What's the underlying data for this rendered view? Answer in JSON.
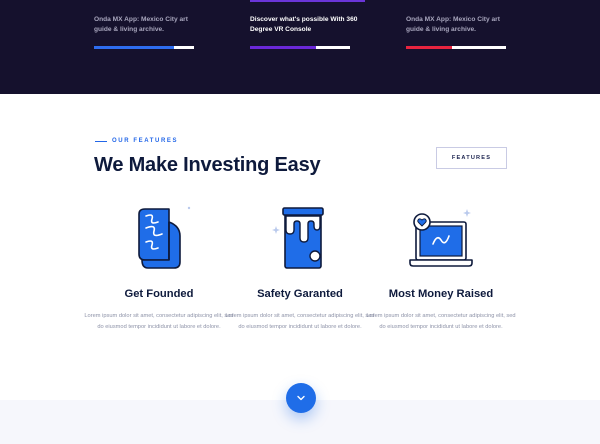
{
  "slider": {
    "slides": [
      {
        "text": "Onda MX App: Mexico City art guide & living archive.",
        "progress": 0.8,
        "color": "#2e6df0"
      },
      {
        "text": "Discover what's possible With 360 Degree VR Console",
        "progress": 0.66,
        "color": "#6a28d8"
      },
      {
        "text": "Onda MX App: Mexico City art guide & living archive.",
        "progress": 0.46,
        "color": "#e8243f"
      }
    ],
    "active_index": 1
  },
  "features_section": {
    "eyebrow": "OUR FEATURES",
    "heading": "We Make Investing Easy",
    "button_label": "FEATURES",
    "items": [
      {
        "title": "Get Founded",
        "icon": "document-icon",
        "description": "Lorem ipsum dolor sit amet, consectetur adipiscing elit, sed do eiusmod tempor incididunt ut labore et dolore."
      },
      {
        "title": "Safety Garanted",
        "icon": "paint-bucket-icon",
        "description": "Lorem ipsum dolor sit amet, consectetur adipiscing elit, sed do eiusmod tempor incididunt ut labore et dolore."
      },
      {
        "title": "Most Money Raised",
        "icon": "laptop-heart-icon",
        "description": "Lorem ipsum dolor sit amet, consectetur adipiscing elit, sed do eiusmod tempor incididunt ut labore et dolore."
      }
    ]
  },
  "scroll_button": {
    "icon": "chevron-down-icon"
  },
  "colors": {
    "accent": "#2266e8",
    "dark_band": "#15112d",
    "heading": "#0e1a3c",
    "icon_blue": "#1f6de8",
    "icon_outline": "#0e1a3c"
  }
}
